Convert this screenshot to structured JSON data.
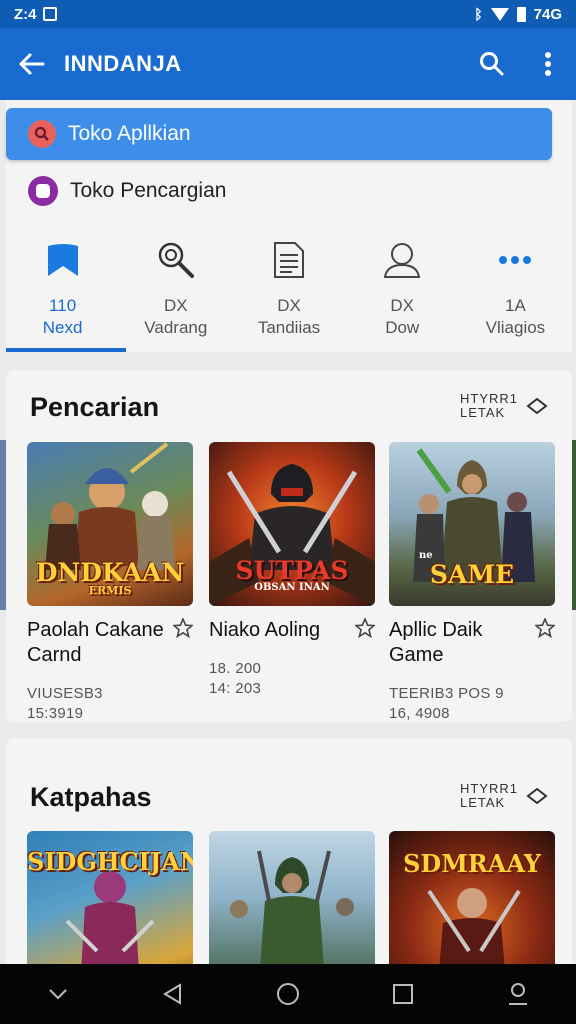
{
  "status": {
    "time": "Z:4",
    "battery_text": "74G"
  },
  "appbar": {
    "title": "INNDANJA"
  },
  "search": {
    "label": "Toko Apllkian"
  },
  "secondary": {
    "label": "Toko Pencargian"
  },
  "tabs": [
    {
      "num": "110",
      "label": "Nexd",
      "icon": "bookmark-icon",
      "active": true
    },
    {
      "num": "DX",
      "label": "Vadrang",
      "icon": "magnifier-icon"
    },
    {
      "num": "DX",
      "label": "Tandiias",
      "icon": "document-icon"
    },
    {
      "num": "DX",
      "label": "Dow",
      "icon": "person-icon"
    },
    {
      "num": "1A",
      "label": "Vliagios",
      "icon": "more-icon"
    }
  ],
  "section1": {
    "title": "Pencarian",
    "more_line1": "HTYRR1",
    "more_line2": "LETAK",
    "games": [
      {
        "thumb_title": "DNDKAAN",
        "thumb_sub": "ERMIS",
        "name": "Paolah Cakane Carnd",
        "meta1": "VIUSESB3",
        "meta2": "15:3919",
        "colors": [
          "#3e6a9e",
          "#c46a2a"
        ]
      },
      {
        "thumb_title": "SUTPAS",
        "thumb_sub": "OBSAN INAN",
        "name": "Niako Aoling",
        "meta1": "18. 200",
        "meta2": "14: 203",
        "colors": [
          "#d8441c",
          "#2a1612"
        ]
      },
      {
        "thumb_title": "SAME",
        "thumb_sub": "ne",
        "name": "Apllic Daik Game",
        "meta1": "TEERIB3 POS 9",
        "meta2": "16, 4908",
        "colors": [
          "#9ab6c8",
          "#4a5a3a"
        ]
      }
    ]
  },
  "section2": {
    "title": "Katpahas",
    "more_line1": "HTYRR1",
    "more_line2": "LETAK",
    "games": [
      {
        "thumb_title": "SIDGHCIJAN",
        "colors": [
          "#2f7fb8",
          "#d9a63a"
        ]
      },
      {
        "thumb_title": "",
        "colors": [
          "#8fb3c9",
          "#3c5a3a"
        ]
      },
      {
        "thumb_title": "SDMRAAY",
        "colors": [
          "#3a1810",
          "#e06a24"
        ]
      }
    ]
  }
}
